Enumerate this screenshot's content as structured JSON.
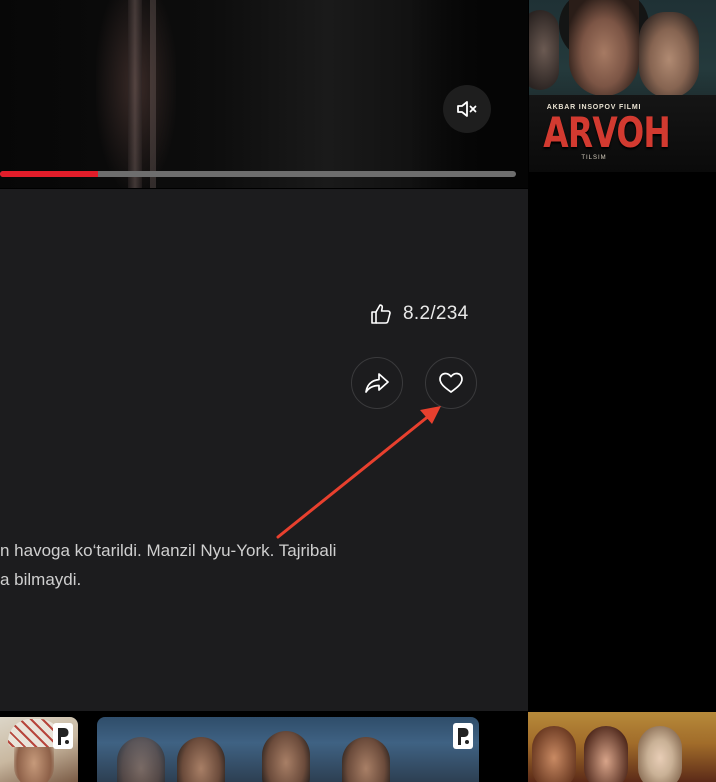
{
  "player": {
    "progress_fraction": 0.19,
    "mute_icon": "volume-mute-icon"
  },
  "info": {
    "rating": "8.2/234",
    "like_icon": "thumbs-up-icon",
    "share_icon": "share-icon",
    "favorite_icon": "heart-icon",
    "description_lines": [
      "n havoga ko‘tarildi. Manzil Nyu-York. Tajribali",
      "a bilmaydi."
    ]
  },
  "poster": {
    "credit": "AKBAR INSOPOV FILMI",
    "title": "ARVOH",
    "subtitle": "TILSIM"
  },
  "annotation": {
    "arrow_color": "#e8402e"
  },
  "colors": {
    "panel_bg": "#1c1c1e",
    "progress": "#e21d2a",
    "accent": "#d23a30"
  }
}
